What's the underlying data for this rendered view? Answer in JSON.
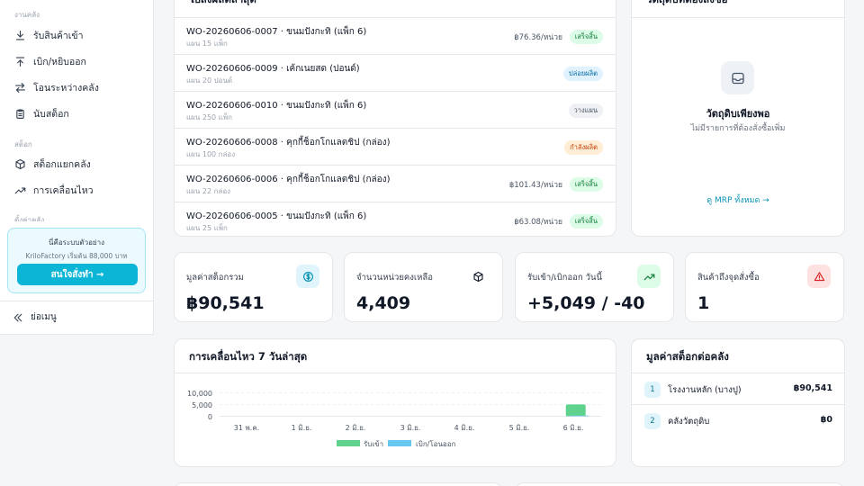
{
  "sidebar": {
    "sections": {
      "warehouse": "งานคลัง",
      "stock": "สต็อก",
      "settings": "ตั้งค่าคลัง"
    },
    "items": [
      {
        "label": "รับสินค้าเข้า",
        "icon": "download-icon"
      },
      {
        "label": "เบิก/หยิบออก",
        "icon": "upload-icon"
      },
      {
        "label": "โอนระหว่างคลัง",
        "icon": "transfer-icon"
      },
      {
        "label": "นับสต็อก",
        "icon": "clipboard-icon"
      },
      {
        "label": "สต็อกแยกคลัง",
        "icon": "box-icon"
      },
      {
        "label": "การเคลื่อนไหว",
        "icon": "trending-up-icon"
      }
    ],
    "promo": {
      "title": "นี่คือระบบตัวอย่าง",
      "subtitle": "KrilоFactory เริ่มต้น 88,000 บาท",
      "button": "สนใจสั่งทำ →"
    },
    "collapse_label": "ย่อเมนู"
  },
  "recent_orders": {
    "title": "ใบสั่งผลิตล่าสุด",
    "rows": [
      {
        "title": "WO-20260606-0007 · ขนมปังกะทิ (แพ็ก 6)",
        "sub": "แผน 15 แพ็ก",
        "price": "฿76.36/หน่วย",
        "status": "เสร็จสิ้น",
        "kind": "done"
      },
      {
        "title": "WO-20260606-0009 · เค้กเนยสด (ปอนด์)",
        "sub": "แผน 20 ปอนด์",
        "price": "",
        "status": "ปล่อยผลิต",
        "kind": "rel"
      },
      {
        "title": "WO-20260606-0010 · ขนมปังกะทิ (แพ็ก 6)",
        "sub": "แผน 250 แพ็ก",
        "price": "",
        "status": "วางแผน",
        "kind": "plan"
      },
      {
        "title": "WO-20260606-0008 · คุกกี้ช็อกโกแลตชิป (กล่อง)",
        "sub": "แผน 100 กล่อง",
        "price": "",
        "status": "กำลังผลิต",
        "kind": "prog"
      },
      {
        "title": "WO-20260606-0006 · คุกกี้ช็อกโกแลตชิป (กล่อง)",
        "sub": "แผน 22 กล่อง",
        "price": "฿101.43/หน่วย",
        "status": "เสร็จสิ้น",
        "kind": "done"
      },
      {
        "title": "WO-20260606-0005 · ขนมปังกะทิ (แพ็ก 6)",
        "sub": "แผน 25 แพ็ก",
        "price": "฿63.08/หน่วย",
        "status": "เสร็จสิ้น",
        "kind": "done"
      }
    ]
  },
  "materials": {
    "title": "วัตถุดิบที่ต้องสั่งซื้อ",
    "empty_title": "วัตถุดิบเพียงพอ",
    "empty_sub": "ไม่มีรายการที่ต้องสั่งซื้อเพิ่ม",
    "link": "ดู MRP ทั้งหมด →"
  },
  "stats": [
    {
      "label": "มูลค่าสต็อกรวม",
      "value": "฿90,541",
      "icon": "dollar-icon",
      "color": "#0891b2",
      "bg": "#e0f5fb"
    },
    {
      "label": "จำนวนหน่วยคงเหลือ",
      "value": "4,409",
      "icon": "box-icon",
      "color": "#111827",
      "bg": "#ffffff"
    },
    {
      "label": "รับเข้า/เบิกออก วันนี้",
      "value": "+5,049 / -40",
      "icon": "trending-up-icon",
      "color": "#15803d",
      "bg": "#dcfce7"
    },
    {
      "label": "สินค้าถึงจุดสั่งซื้อ",
      "value": "1",
      "icon": "alert-icon",
      "color": "#dc2626",
      "bg": "#fee2e2"
    }
  ],
  "movement": {
    "title": "การเคลื่อนไหว 7 วันล่าสุด"
  },
  "warehouses": {
    "title": "มูลค่าสต็อกต่อคลัง",
    "rows": [
      {
        "num": "1",
        "name": "โรงงานหลัก (บางปู)",
        "value": "฿90,541"
      },
      {
        "num": "2",
        "name": "คลังวัตถุดิบ",
        "value": "฿0"
      }
    ]
  },
  "chart_data": {
    "type": "bar",
    "title": "การเคลื่อนไหว 7 วันล่าสุด",
    "categories": [
      "31 พ.ค.",
      "1 มิ.ย.",
      "2 มิ.ย.",
      "3 มิ.ย.",
      "4 มิ.ย.",
      "5 มิ.ย.",
      "6 มิ.ย."
    ],
    "series": [
      {
        "name": "รับเข้า",
        "color": "#5fd38d",
        "values": [
          0,
          0,
          0,
          0,
          0,
          0,
          5049
        ]
      },
      {
        "name": "เบิก/โอนออก",
        "color": "#67c7f0",
        "values": [
          0,
          0,
          0,
          0,
          0,
          0,
          40
        ]
      }
    ],
    "yticks": [
      "10,000",
      "5,000",
      "0"
    ],
    "ylim": [
      0,
      10000
    ],
    "grid": true,
    "legend": "bottom"
  }
}
